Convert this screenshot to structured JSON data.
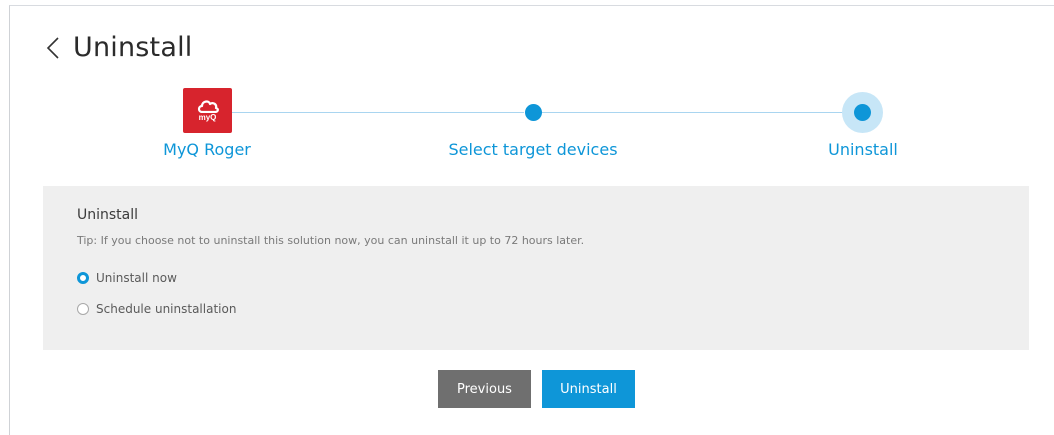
{
  "header": {
    "title": "Uninstall",
    "back_icon": "chevron-left-icon"
  },
  "stepper": {
    "steps": [
      {
        "label": "MyQ Roger",
        "icon": "myq-app-logo",
        "icon_text": "myQ"
      },
      {
        "label": "Select target devices"
      },
      {
        "label": "Uninstall"
      }
    ],
    "active_step": 3,
    "accent_color": "#0e96d8"
  },
  "panel": {
    "title": "Uninstall",
    "tip": "Tip: If you choose not to uninstall this solution now, you can uninstall it up to 72 hours later.",
    "options": [
      {
        "label": "Uninstall now",
        "checked": true
      },
      {
        "label": "Schedule uninstallation",
        "checked": false
      }
    ]
  },
  "buttons": {
    "previous": "Previous",
    "primary": "Uninstall"
  },
  "colors": {
    "primary_button": "#0e96d8",
    "secondary_button": "#6f6f6f",
    "panel_bg": "#efefef"
  }
}
